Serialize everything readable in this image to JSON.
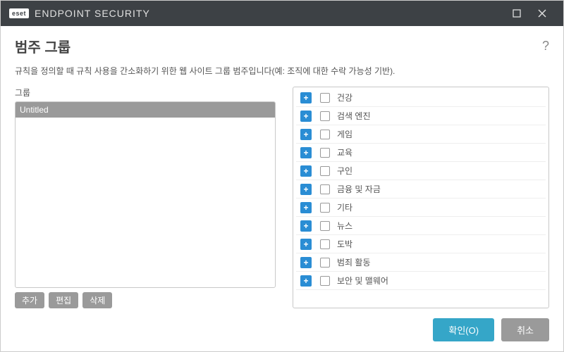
{
  "titlebar": {
    "brand_badge": "eset",
    "brand_text": "ENDPOINT SECURITY"
  },
  "page": {
    "title": "범주 그룹",
    "description": "규칙을 정의할 때 규칙 사용을 간소화하기 위한 웹 사이트 그룹 범주입니다(예: 조직에 대한 수락 가능성 기반)."
  },
  "left": {
    "label": "그룹",
    "items": [
      "Untitled"
    ],
    "actions": {
      "add": "추가",
      "edit": "편집",
      "delete": "삭제"
    }
  },
  "categories": [
    "건강",
    "검색 엔진",
    "게임",
    "교육",
    "구인",
    "금융 및 자금",
    "기타",
    "뉴스",
    "도박",
    "범죄 활동",
    "보안 및 맬웨어"
  ],
  "footer": {
    "ok": "확인(O)",
    "cancel": "취소"
  }
}
